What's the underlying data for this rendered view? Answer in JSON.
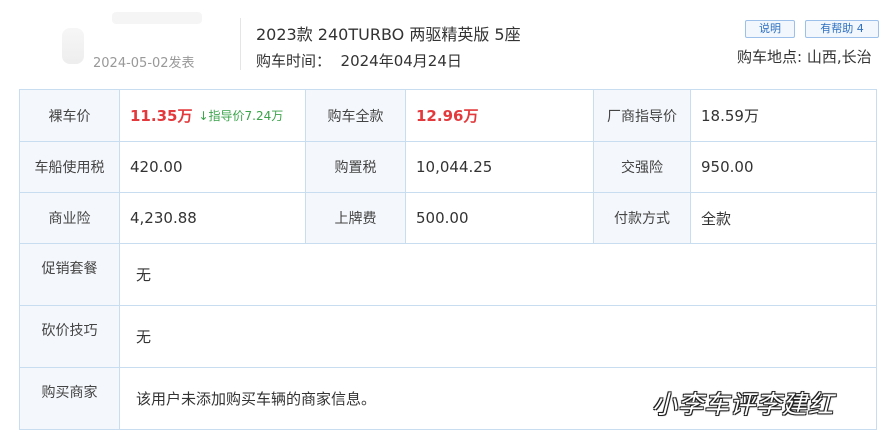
{
  "header": {
    "post_date": "2024-05-02发表",
    "model": "2023款 240TURBO 两驱精英版 5座",
    "buy_time": "购车时间：  2024年04月24日",
    "badges": {
      "explain": "说明",
      "helpful": "有帮助 4"
    },
    "buy_place": "购车地点: 山西,长治"
  },
  "table": {
    "row1": {
      "naked_price_label": "裸车价",
      "naked_price_value": "11.35万",
      "guide_hint_arrow": "↓",
      "guide_hint": "指导价7.24万",
      "total_label": "购车全款",
      "total_value": "12.96万",
      "msrp_label": "厂商指导价",
      "msrp_value": "18.59万"
    },
    "row2": {
      "vessel_tax_label": "车船使用税",
      "vessel_tax_value": "420.00",
      "purchase_tax_label": "购置税",
      "purchase_tax_value": "10,044.25",
      "compulsory_ins_label": "交强险",
      "compulsory_ins_value": "950.00"
    },
    "row3": {
      "commercial_ins_label": "商业险",
      "commercial_ins_value": "4,230.88",
      "plate_fee_label": "上牌费",
      "plate_fee_value": "500.00",
      "payment_label": "付款方式",
      "payment_value": "全款"
    },
    "promo": {
      "label": "促销套餐",
      "value": "无"
    },
    "bargain": {
      "label": "砍价技巧",
      "value": "无"
    },
    "dealer": {
      "label": "购买商家",
      "value": "该用户未添加购买车辆的商家信息。"
    }
  },
  "watermark": "小李车评李建红",
  "colors": {
    "accent_red": "#e4393c",
    "hint_green": "#3aa34a",
    "border_blue": "#c9ddf0",
    "label_bg": "#f4f7fb"
  }
}
